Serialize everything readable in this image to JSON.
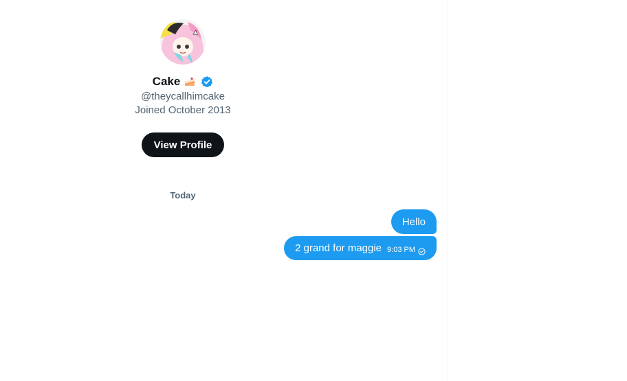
{
  "profile": {
    "display_name": "Cake",
    "handle": "@theycallhimcake",
    "joined": "Joined October 2013",
    "view_profile_label": "View Profile"
  },
  "conversation": {
    "date_label": "Today",
    "messages": [
      {
        "text": "Hello",
        "time": ""
      },
      {
        "text": "2 grand for maggie",
        "time": "9:03 PM"
      }
    ]
  },
  "colors": {
    "accent": "#1d9bf0",
    "button_bg": "#0f1419",
    "secondary_text": "#536471"
  },
  "icons": {
    "verified": "verified-badge-icon",
    "cake_emoji": "cake-emoji-icon",
    "read_receipt": "read-receipt-icon"
  }
}
